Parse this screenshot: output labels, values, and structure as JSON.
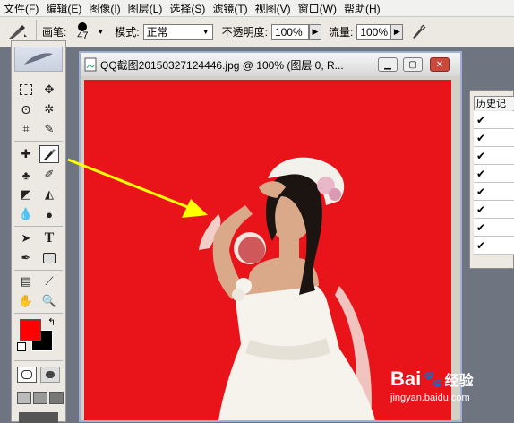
{
  "menu": [
    "文件(F)",
    "编辑(E)",
    "图像(I)",
    "图层(L)",
    "选择(S)",
    "滤镜(T)",
    "视图(V)",
    "窗口(W)",
    "帮助(H)"
  ],
  "options": {
    "brush_label": "画笔:",
    "brush_size": "47",
    "mode_label": "模式:",
    "mode_value": "正常",
    "opacity_label": "不透明度:",
    "opacity_value": "100%",
    "flow_label": "流量:",
    "flow_value": "100%"
  },
  "document": {
    "title": "QQ截图20150327124446.jpg @ 100% (图层 0, R..."
  },
  "history_panel": {
    "tab_label": "历史记",
    "rows_checked": 8
  },
  "watermark": {
    "brand": "Bai",
    "brand2": "经验",
    "url": "jingyan.baidu.com"
  },
  "colors": {
    "foreground": "#ff0000",
    "background": "#000000",
    "canvas_red": "#e8141a",
    "annotation_arrow": "#ffff00"
  }
}
